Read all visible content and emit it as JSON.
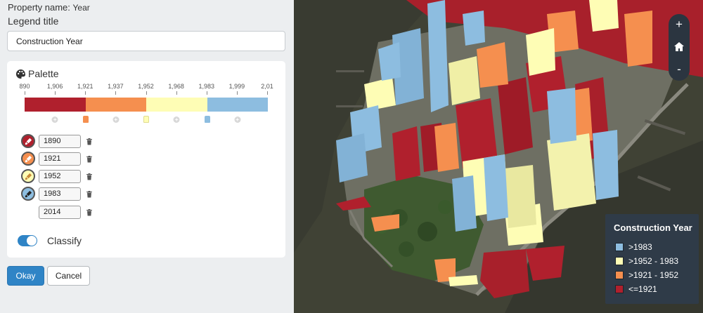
{
  "form": {
    "property_prefix": "Property name:",
    "property_name": "Year",
    "legend_title_label": "Legend title",
    "legend_title_value": "Construction Year"
  },
  "palette": {
    "title": "Palette",
    "ticks": [
      "890",
      "1,906",
      "1,921",
      "1,937",
      "1,952",
      "1,968",
      "1,983",
      "1,999",
      "2,01"
    ],
    "segment_colors": [
      "#b0202d",
      "#f58f4f",
      "#fefdb5",
      "#8dbde0"
    ],
    "stops": [
      {
        "year": "1890",
        "color": "#b0202d",
        "icon": "paint-brush-icon"
      },
      {
        "year": "1921",
        "color": "#f58f4f",
        "icon": "paint-brush-icon"
      },
      {
        "year": "1952",
        "color": "#fefdb5",
        "icon": "paint-brush-icon"
      },
      {
        "year": "1983",
        "color": "#8dbde0",
        "icon": "paint-brush-icon"
      },
      {
        "year": "2014",
        "color": null,
        "icon": null
      }
    ]
  },
  "classify": {
    "label": "Classify",
    "on": true
  },
  "buttons": {
    "ok": "Okay",
    "cancel": "Cancel"
  },
  "map_controls": {
    "zoom_in": "+",
    "home_icon": "home-icon",
    "zoom_out": "-"
  },
  "map_legend": {
    "title": "Construction Year",
    "items": [
      {
        "label": ">1983",
        "color": "#8dbde0"
      },
      {
        "label": ">1952 - 1983",
        "color": "#fefdb5"
      },
      {
        "label": ">1921 - 1952",
        "color": "#f58f4f"
      },
      {
        "label": "<=1921",
        "color": "#b0202d"
      }
    ]
  }
}
